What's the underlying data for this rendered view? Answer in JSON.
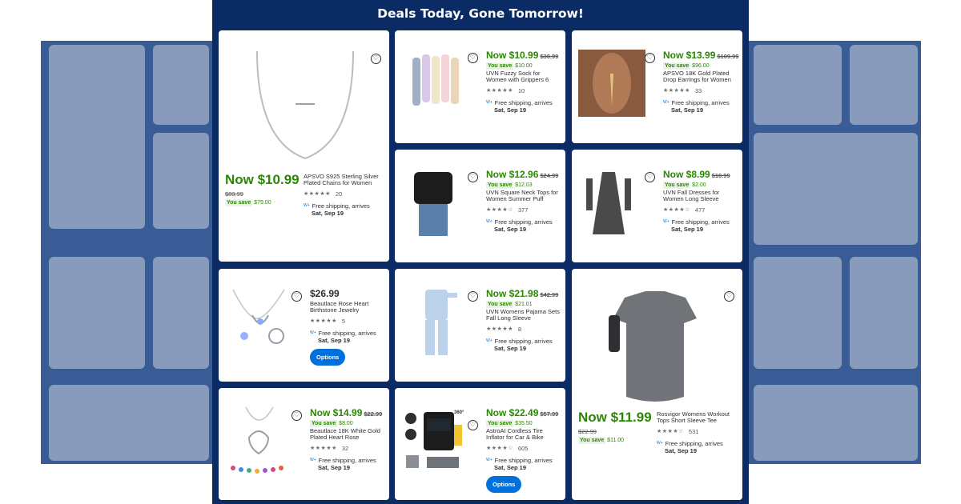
{
  "banner": {
    "title": "Deals Today, Gone Tomorrow!"
  },
  "colors": {
    "panel": "#0b2b65",
    "price_green": "#2a8703",
    "button_blue": "#0071dc"
  },
  "icons": {
    "favorite": "heart-outline-icon",
    "walmart_plus": "walmart-plus-icon",
    "star": "star-icon"
  },
  "cards": [
    {
      "id": "necklace",
      "now": "Now $10.99",
      "was": "$89.99",
      "save_label": "You save",
      "save_amount": "$79.00",
      "title": "APSVO S925 Sterling Silver Plated Chains for Women",
      "stars": "★★★★★",
      "reviews": "20",
      "ship": "Free shipping, arrives",
      "date": "Sat, Sep 19"
    },
    {
      "id": "socks",
      "now": "Now $10.99",
      "was": "$30.99",
      "save_label": "You save",
      "save_amount": "$10.00",
      "title": "UVN Fuzzy Sock for Women with Grippers 6",
      "stars": "★★★★★",
      "reviews": "10",
      "ship": "Free shipping, arrives",
      "date": "Sat, Sep 19"
    },
    {
      "id": "earrings",
      "now": "Now $13.99",
      "was": "$109.99",
      "save_label": "You save",
      "save_amount": "$96.00",
      "title": "APSVO 18K Gold Plated Drop Earrings for Women",
      "stars": "★★★★★",
      "reviews": "33",
      "ship": "Free shipping, arrives",
      "date": "Sat, Sep 19"
    },
    {
      "id": "top",
      "now": "Now $12.96",
      "was": "$24.99",
      "save_label": "You save",
      "save_amount": "$12.03",
      "title": "UVN Square Neck Tops for Women Summer Puff",
      "stars": "★★★★☆",
      "reviews": "377",
      "ship": "Free shipping, arrives",
      "date": "Sat, Sep 19"
    },
    {
      "id": "dress",
      "now": "Now $8.99",
      "was": "$10.99",
      "save_label": "You save",
      "save_amount": "$2.00",
      "title": "UVN Fall Dresses for Women Long Sleeve",
      "stars": "★★★★☆",
      "reviews": "477",
      "ship": "Free shipping, arrives",
      "date": "Sat, Sep 19"
    },
    {
      "id": "jewelry",
      "price": "$26.99",
      "title": "Beautlace Rose Heart Birthstone Jewelry",
      "stars": "★★★★★",
      "reviews": "5",
      "ship": "Free shipping, arrives",
      "date": "Sat, Sep 19",
      "options": "Options"
    },
    {
      "id": "pajama",
      "now": "Now $21.98",
      "was": "$42.99",
      "save_label": "You save",
      "save_amount": "$21.01",
      "title": "UVN Womens Pajama Sets Fall Long Sleeve",
      "stars": "★★★★★",
      "reviews": "8",
      "ship": "Free shipping, arrives",
      "date": "Sat, Sep 19"
    },
    {
      "id": "tee",
      "now": "Now $11.99",
      "was": "$22.99",
      "save_label": "You save",
      "save_amount": "$11.00",
      "title": "Rosvigor Womens Workout Tops Short Sleeve Tee",
      "stars": "★★★★☆",
      "reviews": "531",
      "ship": "Free shipping, arrives",
      "date": "Sat, Sep 19"
    },
    {
      "id": "rose_necklace",
      "now": "Now $14.99",
      "was": "$22.99",
      "save_label": "You save",
      "save_amount": "$8.00",
      "title": "Beautlace 18K White Gold Plated Heart Rose",
      "stars": "★★★★★",
      "reviews": "32",
      "ship": "Free shipping, arrives",
      "date": "Sat, Sep 19"
    },
    {
      "id": "inflator",
      "now": "Now $22.49",
      "was": "$57.99",
      "save_label": "You save",
      "save_amount": "$35.50",
      "title": "AstroAI Cordless Tire Inflator for Car & Bike",
      "stars": "★★★★☆",
      "reviews": "605",
      "ship": "Free shipping, arrives",
      "date": "Sat, Sep 19",
      "options": "Options",
      "badge": "360°"
    }
  ]
}
